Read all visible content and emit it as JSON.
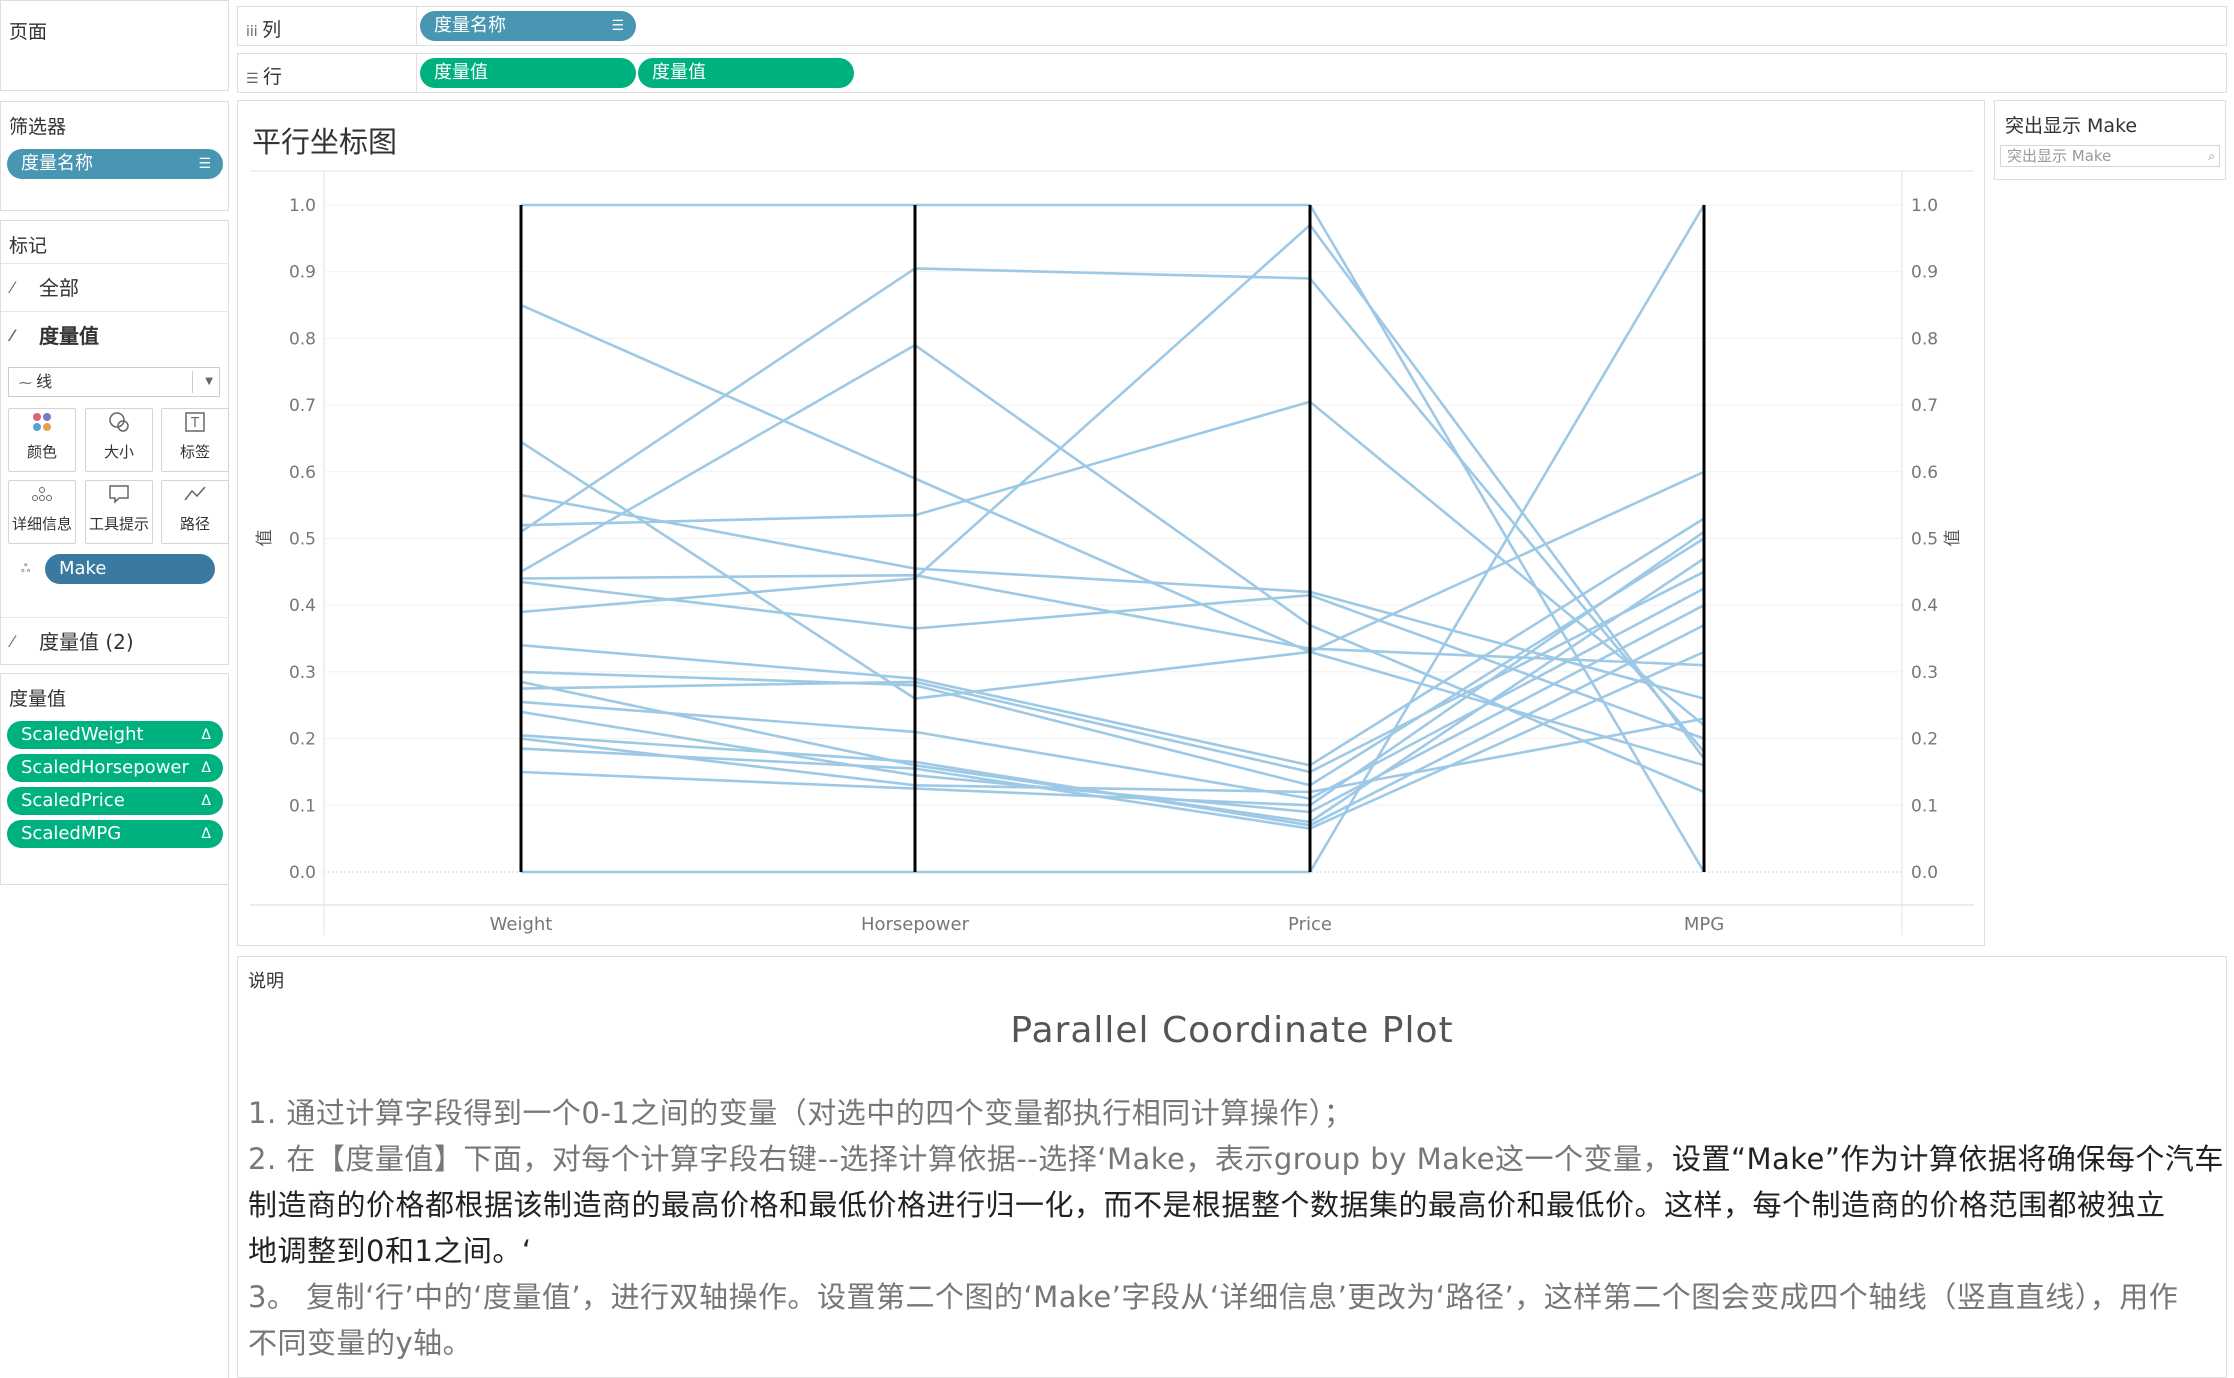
{
  "left": {
    "pages_title": "页面",
    "filters_title": "筛选器",
    "filter_pill": "度量名称",
    "marks_title": "标记",
    "marks_all": "全部",
    "marks_measure": "度量值",
    "mark_type": "线",
    "buttons": {
      "color": "颜色",
      "size": "大小",
      "label": "标签",
      "detail": "详细信息",
      "tooltip": "工具提示",
      "path": "路径"
    },
    "make_pill": "Make",
    "marks_measure2": "度量值 (2)",
    "measures_title": "度量值",
    "measures": [
      "ScaledWeight",
      "ScaledHorsepower",
      "ScaledPrice",
      "ScaledMPG"
    ]
  },
  "shelves": {
    "columns_label": "列",
    "columns_pill": "度量名称",
    "rows_label": "行",
    "rows_pills": [
      "度量值",
      "度量值"
    ]
  },
  "chart": {
    "title": "平行坐标图"
  },
  "highlight": {
    "title": "突出显示 Make",
    "placeholder": "突出显示 Make"
  },
  "notes": {
    "label": "说明",
    "heading": "Parallel Coordinate Plot",
    "line1": "1. 通过计算字段得到一个0-1之间的变量（对选中的四个变量都执行相同计算操作）；",
    "line2a": "2. 在【度量值】下面，对每个计算字段右键--选择计算依据--选择‘Make，表示group by Make这一个变量，",
    "line2b": "设置“Make”作为计算依据将确保每个汽车",
    "line3": "制造商的价格都根据该制造商的最高价格和最低价格进行归一化，而不是根据整个数据集的最高价和最低价。这样，每个制造商的价格范围都被独立",
    "line4": "地调整到0和1之间。‘",
    "line5": "3。 复制‘行’中的‘度量值’，进行双轴操作。设置第二个图的‘Make’字段从‘详细信息’更改为‘路径’，这样第二个图会变成四个轴线（竖直直线），用作",
    "line6": "不同变量的y轴。"
  },
  "chart_data": {
    "type": "line",
    "categories": [
      "Weight",
      "Horsepower",
      "Price",
      "MPG"
    ],
    "ylabel": "值",
    "ylim": [
      0,
      1
    ],
    "yticks": [
      "0.0",
      "0.1",
      "0.2",
      "0.3",
      "0.4",
      "0.5",
      "0.6",
      "0.7",
      "0.8",
      "0.9",
      "1.0"
    ],
    "line_color": "#9ec9e6",
    "axis_color": "#000000",
    "series": [
      {
        "values": [
          1.0,
          1.0,
          1.0,
          0.0
        ]
      },
      {
        "values": [
          0.0,
          0.0,
          0.0,
          1.0
        ]
      },
      {
        "values": [
          0.85,
          0.59,
          0.33,
          0.16
        ]
      },
      {
        "values": [
          0.51,
          0.905,
          0.89,
          0.18
        ]
      },
      {
        "values": [
          0.45,
          0.79,
          0.37,
          0.12
        ]
      },
      {
        "values": [
          0.52,
          0.535,
          0.705,
          0.22
        ]
      },
      {
        "values": [
          0.645,
          0.26,
          0.33,
          0.6
        ]
      },
      {
        "values": [
          0.565,
          0.455,
          0.42,
          0.26
        ]
      },
      {
        "values": [
          0.44,
          0.445,
          0.335,
          0.31
        ]
      },
      {
        "values": [
          0.435,
          0.365,
          0.415,
          0.2
        ]
      },
      {
        "values": [
          0.39,
          0.44,
          0.97,
          0.17
        ]
      },
      {
        "values": [
          0.34,
          0.29,
          0.16,
          0.53
        ]
      },
      {
        "values": [
          0.3,
          0.28,
          0.13,
          0.5
        ]
      },
      {
        "values": [
          0.285,
          0.16,
          0.075,
          0.47
        ]
      },
      {
        "values": [
          0.275,
          0.285,
          0.15,
          0.45
        ]
      },
      {
        "values": [
          0.255,
          0.21,
          0.11,
          0.425
        ]
      },
      {
        "values": [
          0.24,
          0.145,
          0.09,
          0.4
        ]
      },
      {
        "values": [
          0.205,
          0.165,
          0.07,
          0.37
        ]
      },
      {
        "values": [
          0.185,
          0.155,
          0.065,
          0.33
        ]
      },
      {
        "values": [
          0.15,
          0.125,
          0.1,
          0.51
        ]
      },
      {
        "values": [
          0.2,
          0.13,
          0.12,
          0.23
        ]
      }
    ]
  }
}
